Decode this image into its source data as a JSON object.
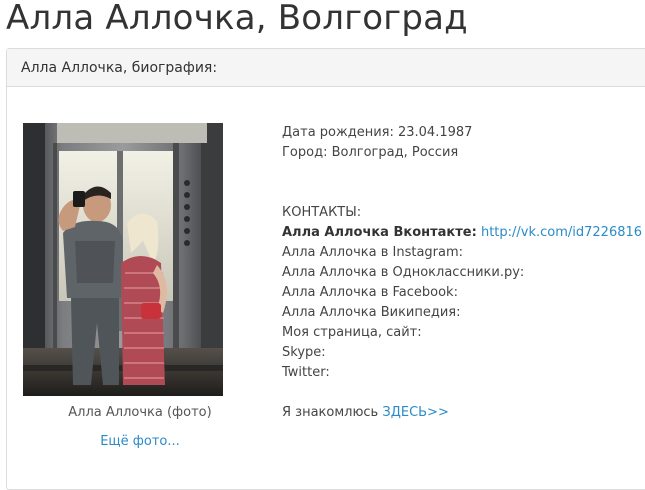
{
  "page": {
    "title": "Алла Аллочка, Волгоград"
  },
  "panel": {
    "heading": "Алла Аллочка, биография:"
  },
  "photo": {
    "caption": "Алла Аллочка (фото)",
    "more_link": "Ещё фото..."
  },
  "info": {
    "birth": "Дата рождения: 23.04.1987",
    "city": "Город: Волгоград, Россия",
    "contacts_label": "КОНТАКТЫ:",
    "vk_label": "Алла Аллочка Вконтакте:",
    "vk_link": "http://vk.com/id7226816",
    "instagram": "Алла Аллочка в Instagram:",
    "odnoklassniki": "Алла Аллочка в Одноклассники.ру:",
    "facebook": "Алла Аллочка в Facebook:",
    "wikipedia": "Алла Аллочка Википедия:",
    "site": "Моя страница, сайт:",
    "skype": "Skype:",
    "twitter": "Twitter:",
    "meet_text": "Я знакомлюсь",
    "meet_link": "ЗДЕСЬ>>"
  }
}
